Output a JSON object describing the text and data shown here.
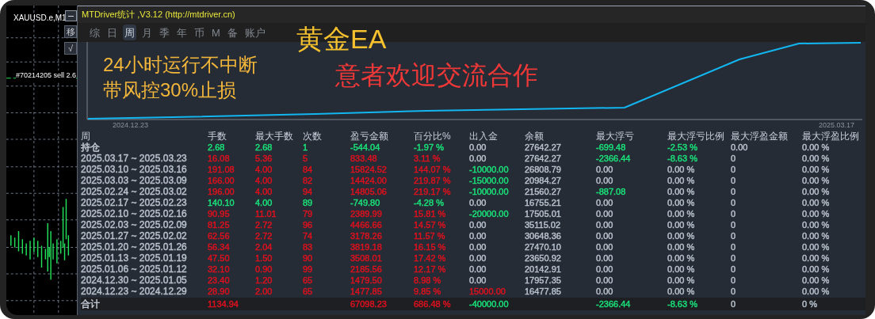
{
  "chart_window": {
    "symbol": "XAUUSD.e,M1",
    "order_label": "#70214205 sell 2.6",
    "buttons": [
      {
        "kind": "minimize"
      },
      {
        "kind": "text",
        "label": "移"
      },
      {
        "kind": "text",
        "label": "√"
      }
    ]
  },
  "panel": {
    "title": "MTDriver统计 ,V3.12 (http://mtdriver.cn)",
    "tabs": [
      {
        "label": "综",
        "selected": false
      },
      {
        "label": "日",
        "selected": false
      },
      {
        "label": "周",
        "selected": true
      },
      {
        "label": "月",
        "selected": false
      },
      {
        "label": "季",
        "selected": false
      },
      {
        "label": "年",
        "selected": false
      },
      {
        "label": "币",
        "selected": false
      },
      {
        "label": "M",
        "selected": false
      },
      {
        "label": "备",
        "selected": false
      },
      {
        "label": "账户",
        "selected": false
      }
    ],
    "banner": {
      "title": "黄金EA",
      "lines": [
        "24小时运行不中断",
        "带风控30%止损"
      ],
      "slogan": "意者欢迎交流合作"
    },
    "equity_chart": {
      "start_label": "2024.12.23",
      "end_label": "2025.03.17"
    },
    "table": {
      "columns": [
        "周",
        "手数",
        "最大手数",
        "次数",
        "盈亏金额",
        "百分比%",
        "出入金",
        "余额",
        "最大浮亏",
        "最大浮亏比例",
        "最大浮盈金额",
        "最大浮盈比例"
      ],
      "rows": [
        {
          "cells": [
            {
              "text": "持仓",
              "color": "#c4ccd6"
            },
            {
              "text": "2.68",
              "color": "#19e27a"
            },
            {
              "text": "2.68",
              "color": "#19e27a"
            },
            {
              "text": "1",
              "color": "#19e27a"
            },
            {
              "text": "-544.04",
              "color": "#19e27a"
            },
            {
              "text": "-1.97 %",
              "color": "#19e27a"
            },
            {
              "text": "0.00",
              "color": "#b8c2ce"
            },
            {
              "text": "27642.27",
              "color": "#b8c2ce"
            },
            {
              "text": "-699.48",
              "color": "#19e27a"
            },
            {
              "text": "-2.53 %",
              "color": "#19e27a"
            },
            {
              "text": "0.00",
              "color": "#b8c2ce"
            },
            {
              "text": "0.00 %",
              "color": "#b8c2ce"
            }
          ]
        },
        {
          "cells": [
            {
              "text": "2025.03.17 ~ 2025.03.23",
              "color": "#b8c2ce"
            },
            {
              "text": "16.08",
              "color": "#e0101e"
            },
            {
              "text": "5.36",
              "color": "#e0101e"
            },
            {
              "text": "5",
              "color": "#e0101e"
            },
            {
              "text": "833.48",
              "color": "#e0101e"
            },
            {
              "text": "3.11 %",
              "color": "#e0101e"
            },
            {
              "text": "0.00",
              "color": "#b8c2ce"
            },
            {
              "text": "27642.27",
              "color": "#b8c2ce"
            },
            {
              "text": "-2366.44",
              "color": "#19e27a"
            },
            {
              "text": "-8.63 %",
              "color": "#19e27a"
            },
            {
              "text": "0",
              "color": "#b8c2ce"
            },
            {
              "text": "0.00 %",
              "color": "#b8c2ce"
            }
          ]
        },
        {
          "cells": [
            {
              "text": "2025.03.10 ~ 2025.03.16",
              "color": "#b8c2ce"
            },
            {
              "text": "191.08",
              "color": "#e0101e"
            },
            {
              "text": "4.00",
              "color": "#e0101e"
            },
            {
              "text": "84",
              "color": "#e0101e"
            },
            {
              "text": "15824.52",
              "color": "#e0101e"
            },
            {
              "text": "144.07 %",
              "color": "#e0101e"
            },
            {
              "text": "-10000.00",
              "color": "#19e27a"
            },
            {
              "text": "26808.79",
              "color": "#b8c2ce"
            },
            {
              "text": "0.00",
              "color": "#b8c2ce"
            },
            {
              "text": "0.00 %",
              "color": "#b8c2ce"
            },
            {
              "text": "0",
              "color": "#b8c2ce"
            },
            {
              "text": "0.00 %",
              "color": "#b8c2ce"
            }
          ]
        },
        {
          "cells": [
            {
              "text": "2025.03.03 ~ 2025.03.09",
              "color": "#b8c2ce"
            },
            {
              "text": "166.00",
              "color": "#e0101e"
            },
            {
              "text": "4.00",
              "color": "#e0101e"
            },
            {
              "text": "82",
              "color": "#e0101e"
            },
            {
              "text": "14424.00",
              "color": "#e0101e"
            },
            {
              "text": "219.87 %",
              "color": "#e0101e"
            },
            {
              "text": "-15000.00",
              "color": "#19e27a"
            },
            {
              "text": "20984.27",
              "color": "#b8c2ce"
            },
            {
              "text": "0.00",
              "color": "#b8c2ce"
            },
            {
              "text": "0.00 %",
              "color": "#b8c2ce"
            },
            {
              "text": "0",
              "color": "#b8c2ce"
            },
            {
              "text": "0.00 %",
              "color": "#b8c2ce"
            }
          ]
        },
        {
          "cells": [
            {
              "text": "2025.02.24 ~ 2025.03.02",
              "color": "#b8c2ce"
            },
            {
              "text": "196.00",
              "color": "#e0101e"
            },
            {
              "text": "4.00",
              "color": "#e0101e"
            },
            {
              "text": "94",
              "color": "#e0101e"
            },
            {
              "text": "14805.06",
              "color": "#e0101e"
            },
            {
              "text": "219.17 %",
              "color": "#e0101e"
            },
            {
              "text": "-10000.00",
              "color": "#19e27a"
            },
            {
              "text": "21560.27",
              "color": "#b8c2ce"
            },
            {
              "text": "-887.08",
              "color": "#19e27a"
            },
            {
              "text": "0.00 %",
              "color": "#b8c2ce"
            },
            {
              "text": "0",
              "color": "#b8c2ce"
            },
            {
              "text": "0.00 %",
              "color": "#b8c2ce"
            }
          ]
        },
        {
          "cells": [
            {
              "text": "2025.02.17 ~ 2025.02.23",
              "color": "#b8c2ce"
            },
            {
              "text": "140.10",
              "color": "#19e27a"
            },
            {
              "text": "4.00",
              "color": "#19e27a"
            },
            {
              "text": "89",
              "color": "#19e27a"
            },
            {
              "text": "-749.80",
              "color": "#19e27a"
            },
            {
              "text": "-4.28 %",
              "color": "#19e27a"
            },
            {
              "text": "0.00",
              "color": "#b8c2ce"
            },
            {
              "text": "16755.21",
              "color": "#b8c2ce"
            },
            {
              "text": "0.00",
              "color": "#b8c2ce"
            },
            {
              "text": "0.00 %",
              "color": "#b8c2ce"
            },
            {
              "text": "0",
              "color": "#b8c2ce"
            },
            {
              "text": "0.00 %",
              "color": "#b8c2ce"
            }
          ]
        },
        {
          "cells": [
            {
              "text": "2025.02.10 ~ 2025.02.16",
              "color": "#b8c2ce"
            },
            {
              "text": "90.95",
              "color": "#e0101e"
            },
            {
              "text": "11.01",
              "color": "#e0101e"
            },
            {
              "text": "79",
              "color": "#e0101e"
            },
            {
              "text": "2389.99",
              "color": "#e0101e"
            },
            {
              "text": "15.81 %",
              "color": "#e0101e"
            },
            {
              "text": "-20000.00",
              "color": "#19e27a"
            },
            {
              "text": "17505.01",
              "color": "#b8c2ce"
            },
            {
              "text": "0.00",
              "color": "#b8c2ce"
            },
            {
              "text": "0.00 %",
              "color": "#b8c2ce"
            },
            {
              "text": "0",
              "color": "#b8c2ce"
            },
            {
              "text": "0.00 %",
              "color": "#b8c2ce"
            }
          ]
        },
        {
          "cells": [
            {
              "text": "2025.02.03 ~ 2025.02.09",
              "color": "#b8c2ce"
            },
            {
              "text": "81.25",
              "color": "#e0101e"
            },
            {
              "text": "2.72",
              "color": "#e0101e"
            },
            {
              "text": "96",
              "color": "#e0101e"
            },
            {
              "text": "4466.66",
              "color": "#e0101e"
            },
            {
              "text": "14.57 %",
              "color": "#e0101e"
            },
            {
              "text": "0.00",
              "color": "#b8c2ce"
            },
            {
              "text": "35115.02",
              "color": "#b8c2ce"
            },
            {
              "text": "0.00",
              "color": "#b8c2ce"
            },
            {
              "text": "0.00 %",
              "color": "#b8c2ce"
            },
            {
              "text": "0",
              "color": "#b8c2ce"
            },
            {
              "text": "0.00 %",
              "color": "#b8c2ce"
            }
          ]
        },
        {
          "cells": [
            {
              "text": "2025.01.27 ~ 2025.02.02",
              "color": "#b8c2ce"
            },
            {
              "text": "62.56",
              "color": "#e0101e"
            },
            {
              "text": "2.72",
              "color": "#e0101e"
            },
            {
              "text": "74",
              "color": "#e0101e"
            },
            {
              "text": "3178.26",
              "color": "#e0101e"
            },
            {
              "text": "11.57 %",
              "color": "#e0101e"
            },
            {
              "text": "0.00",
              "color": "#b8c2ce"
            },
            {
              "text": "30648.36",
              "color": "#b8c2ce"
            },
            {
              "text": "0.00",
              "color": "#b8c2ce"
            },
            {
              "text": "0.00 %",
              "color": "#b8c2ce"
            },
            {
              "text": "0",
              "color": "#b8c2ce"
            },
            {
              "text": "0.00 %",
              "color": "#b8c2ce"
            }
          ]
        },
        {
          "cells": [
            {
              "text": "2025.01.20 ~ 2025.01.26",
              "color": "#b8c2ce"
            },
            {
              "text": "56.34",
              "color": "#e0101e"
            },
            {
              "text": "2.04",
              "color": "#e0101e"
            },
            {
              "text": "83",
              "color": "#e0101e"
            },
            {
              "text": "3819.18",
              "color": "#e0101e"
            },
            {
              "text": "16.15 %",
              "color": "#e0101e"
            },
            {
              "text": "0.00",
              "color": "#b8c2ce"
            },
            {
              "text": "27470.10",
              "color": "#b8c2ce"
            },
            {
              "text": "0.00",
              "color": "#b8c2ce"
            },
            {
              "text": "0.00 %",
              "color": "#b8c2ce"
            },
            {
              "text": "0",
              "color": "#b8c2ce"
            },
            {
              "text": "0.00 %",
              "color": "#b8c2ce"
            }
          ]
        },
        {
          "cells": [
            {
              "text": "2025.01.13 ~ 2025.01.19",
              "color": "#b8c2ce"
            },
            {
              "text": "47.50",
              "color": "#e0101e"
            },
            {
              "text": "1.50",
              "color": "#e0101e"
            },
            {
              "text": "90",
              "color": "#e0101e"
            },
            {
              "text": "3508.01",
              "color": "#e0101e"
            },
            {
              "text": "17.42 %",
              "color": "#e0101e"
            },
            {
              "text": "0.00",
              "color": "#b8c2ce"
            },
            {
              "text": "23650.92",
              "color": "#b8c2ce"
            },
            {
              "text": "0.00",
              "color": "#b8c2ce"
            },
            {
              "text": "0.00 %",
              "color": "#b8c2ce"
            },
            {
              "text": "0",
              "color": "#b8c2ce"
            },
            {
              "text": "0.00 %",
              "color": "#b8c2ce"
            }
          ]
        },
        {
          "cells": [
            {
              "text": "2025.01.06 ~ 2025.01.12",
              "color": "#b8c2ce"
            },
            {
              "text": "32.10",
              "color": "#e0101e"
            },
            {
              "text": "0.90",
              "color": "#e0101e"
            },
            {
              "text": "99",
              "color": "#e0101e"
            },
            {
              "text": "2185.56",
              "color": "#e0101e"
            },
            {
              "text": "12.17 %",
              "color": "#e0101e"
            },
            {
              "text": "0.00",
              "color": "#b8c2ce"
            },
            {
              "text": "20142.91",
              "color": "#b8c2ce"
            },
            {
              "text": "0.00",
              "color": "#b8c2ce"
            },
            {
              "text": "0.00 %",
              "color": "#b8c2ce"
            },
            {
              "text": "0",
              "color": "#b8c2ce"
            },
            {
              "text": "0.00 %",
              "color": "#b8c2ce"
            }
          ]
        },
        {
          "cells": [
            {
              "text": "2024.12.30 ~ 2025.01.05",
              "color": "#b8c2ce"
            },
            {
              "text": "23.40",
              "color": "#e0101e"
            },
            {
              "text": "1.20",
              "color": "#e0101e"
            },
            {
              "text": "65",
              "color": "#e0101e"
            },
            {
              "text": "1479.50",
              "color": "#e0101e"
            },
            {
              "text": "8.98 %",
              "color": "#e0101e"
            },
            {
              "text": "0.00",
              "color": "#b8c2ce"
            },
            {
              "text": "17957.35",
              "color": "#b8c2ce"
            },
            {
              "text": "0.00",
              "color": "#b8c2ce"
            },
            {
              "text": "0.00 %",
              "color": "#b8c2ce"
            },
            {
              "text": "0",
              "color": "#b8c2ce"
            },
            {
              "text": "0.00 %",
              "color": "#b8c2ce"
            }
          ]
        },
        {
          "cells": [
            {
              "text": "2024.12.23 ~ 2024.12.29",
              "color": "#b8c2ce"
            },
            {
              "text": "28.90",
              "color": "#e0101e"
            },
            {
              "text": "2.00",
              "color": "#e0101e"
            },
            {
              "text": "65",
              "color": "#e0101e"
            },
            {
              "text": "1477.85",
              "color": "#e0101e"
            },
            {
              "text": "9.85 %",
              "color": "#e0101e"
            },
            {
              "text": "15000.00",
              "color": "#e0101e"
            },
            {
              "text": "16477.85",
              "color": "#b8c2ce"
            },
            {
              "text": "0.00",
              "color": "#b8c2ce"
            },
            {
              "text": "0.00 %",
              "color": "#b8c2ce"
            },
            {
              "text": "0",
              "color": "#b8c2ce"
            },
            {
              "text": "0.00 %",
              "color": "#b8c2ce"
            }
          ]
        }
      ],
      "total_row": {
        "cells": [
          {
            "text": "合计",
            "color": "#c4ccd6"
          },
          {
            "text": "1134.94",
            "color": "#e0101e"
          },
          null,
          null,
          {
            "text": "67098.23",
            "color": "#e0101e"
          },
          {
            "text": "686.48 %",
            "color": "#e0101e"
          },
          {
            "text": "-40000.00",
            "color": "#19e27a"
          },
          null,
          {
            "text": "-2366.44",
            "color": "#19e27a"
          },
          {
            "text": "-8.63 %",
            "color": "#19e27a"
          },
          {
            "text": "0",
            "color": "#b8c2ce"
          },
          {
            "text": "0 %",
            "color": "#b8c2ce"
          }
        ]
      }
    }
  }
}
